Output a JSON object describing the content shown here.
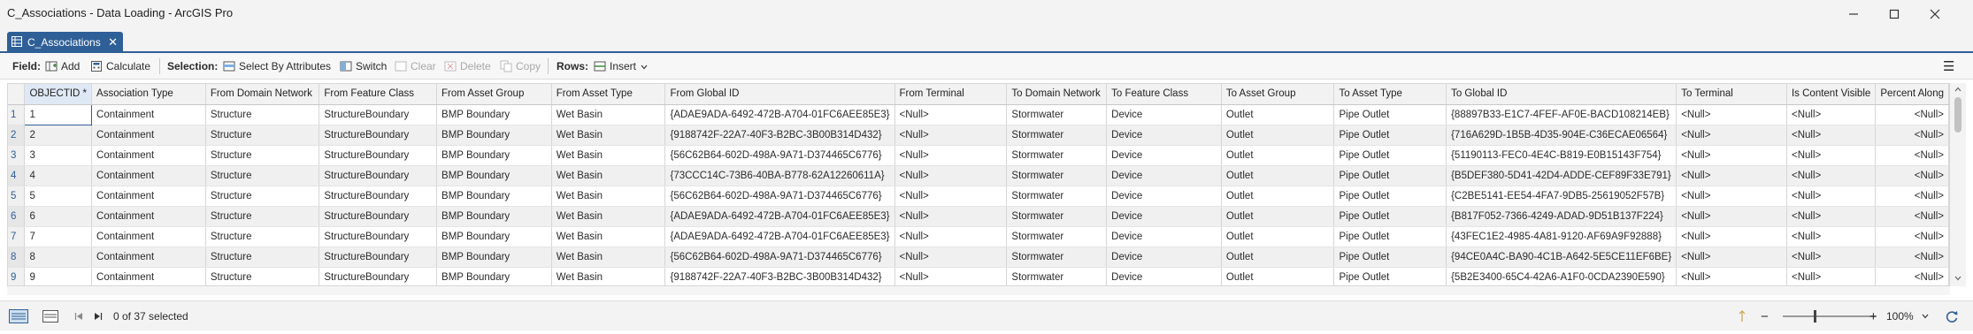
{
  "window": {
    "title": "C_Associations - Data Loading - ArcGIS Pro",
    "minimize_label": "—",
    "maximize_label": "☐",
    "close_label": "✕"
  },
  "tab": {
    "label": "C_Associations",
    "close_label": "✕"
  },
  "toolbar": {
    "field_label": "Field:",
    "add_label": "Add",
    "calculate_label": "Calculate",
    "selection_label": "Selection:",
    "select_by_attributes_label": "Select By Attributes",
    "switch_label": "Switch",
    "clear_label": "Clear",
    "delete_label": "Delete",
    "copy_label": "Copy",
    "rows_label": "Rows:",
    "insert_label": "Insert",
    "menu_label": "☰"
  },
  "table": {
    "columns": [
      "OBJECTID *",
      "Association Type",
      "From Domain Network",
      "From Feature Class",
      "From Asset Group",
      "From Asset Type",
      "From Global ID",
      "From Terminal",
      "To Domain Network",
      "To Feature Class",
      "To Asset Group",
      "To Asset Type",
      "To Global ID",
      "To Terminal",
      "Is Content Visible",
      "Percent Along"
    ],
    "rows": [
      [
        "1",
        "1",
        "Containment",
        "Structure",
        "StructureBoundary",
        "BMP Boundary",
        "Wet Basin",
        "{ADAE9ADA-6492-472B-A704-01FC6AEE85E3}",
        "<Null>",
        "Stormwater",
        "Device",
        "Outlet",
        "Pipe Outlet",
        "{88897B33-E1C7-4FEF-AF0E-BACD108214EB}",
        "<Null>",
        "<Null>",
        "<Null>"
      ],
      [
        "2",
        "2",
        "Containment",
        "Structure",
        "StructureBoundary",
        "BMP Boundary",
        "Wet Basin",
        "{9188742F-22A7-40F3-B2BC-3B00B314D432}",
        "<Null>",
        "Stormwater",
        "Device",
        "Outlet",
        "Pipe Outlet",
        "{716A629D-1B5B-4D35-904E-C36ECAE06564}",
        "<Null>",
        "<Null>",
        "<Null>"
      ],
      [
        "3",
        "3",
        "Containment",
        "Structure",
        "StructureBoundary",
        "BMP Boundary",
        "Wet Basin",
        "{56C62B64-602D-498A-9A71-D374465C6776}",
        "<Null>",
        "Stormwater",
        "Device",
        "Outlet",
        "Pipe Outlet",
        "{51190113-FEC0-4E4C-B819-E0B15143F754}",
        "<Null>",
        "<Null>",
        "<Null>"
      ],
      [
        "4",
        "4",
        "Containment",
        "Structure",
        "StructureBoundary",
        "BMP Boundary",
        "Wet Basin",
        "{73CCC14C-73B6-40BA-B778-62A12260611A}",
        "<Null>",
        "Stormwater",
        "Device",
        "Outlet",
        "Pipe Outlet",
        "{B5DEF380-5D41-42D4-ADDE-CEF89F33E791}",
        "<Null>",
        "<Null>",
        "<Null>"
      ],
      [
        "5",
        "5",
        "Containment",
        "Structure",
        "StructureBoundary",
        "BMP Boundary",
        "Wet Basin",
        "{56C62B64-602D-498A-9A71-D374465C6776}",
        "<Null>",
        "Stormwater",
        "Device",
        "Outlet",
        "Pipe Outlet",
        "{C2BE5141-EE54-4FA7-9DB5-25619052F57B}",
        "<Null>",
        "<Null>",
        "<Null>"
      ],
      [
        "6",
        "6",
        "Containment",
        "Structure",
        "StructureBoundary",
        "BMP Boundary",
        "Wet Basin",
        "{ADAE9ADA-6492-472B-A704-01FC6AEE85E3}",
        "<Null>",
        "Stormwater",
        "Device",
        "Outlet",
        "Pipe Outlet",
        "{B817F052-7366-4249-ADAD-9D51B137F224}",
        "<Null>",
        "<Null>",
        "<Null>"
      ],
      [
        "7",
        "7",
        "Containment",
        "Structure",
        "StructureBoundary",
        "BMP Boundary",
        "Wet Basin",
        "{ADAE9ADA-6492-472B-A704-01FC6AEE85E3}",
        "<Null>",
        "Stormwater",
        "Device",
        "Outlet",
        "Pipe Outlet",
        "{43FEC1E2-4985-4A81-9120-AF69A9F92888}",
        "<Null>",
        "<Null>",
        "<Null>"
      ],
      [
        "8",
        "8",
        "Containment",
        "Structure",
        "StructureBoundary",
        "BMP Boundary",
        "Wet Basin",
        "{56C62B64-602D-498A-9A71-D374465C6776}",
        "<Null>",
        "Stormwater",
        "Device",
        "Outlet",
        "Pipe Outlet",
        "{94CE0A4C-BA90-4C1B-A642-5E5CE11EF6BE}",
        "<Null>",
        "<Null>",
        "<Null>"
      ],
      [
        "9",
        "9",
        "Containment",
        "Structure",
        "StructureBoundary",
        "BMP Boundary",
        "Wet Basin",
        "{9188742F-22A7-40F3-B2BC-3B00B314D432}",
        "<Null>",
        "Stormwater",
        "Device",
        "Outlet",
        "Pipe Outlet",
        "{5B2E3400-65C4-42A6-A1F0-0CDA2390E590}",
        "<Null>",
        "<Null>",
        "<Null>"
      ]
    ]
  },
  "status": {
    "selected_text": "0 of 37 selected",
    "zoom_text": "100%",
    "zoom_minus": "−",
    "zoom_plus": "+",
    "zoom_dropdown": "⌄"
  },
  "colors": {
    "accent": "#2f5f97",
    "null_text": "#2b2b2b"
  }
}
